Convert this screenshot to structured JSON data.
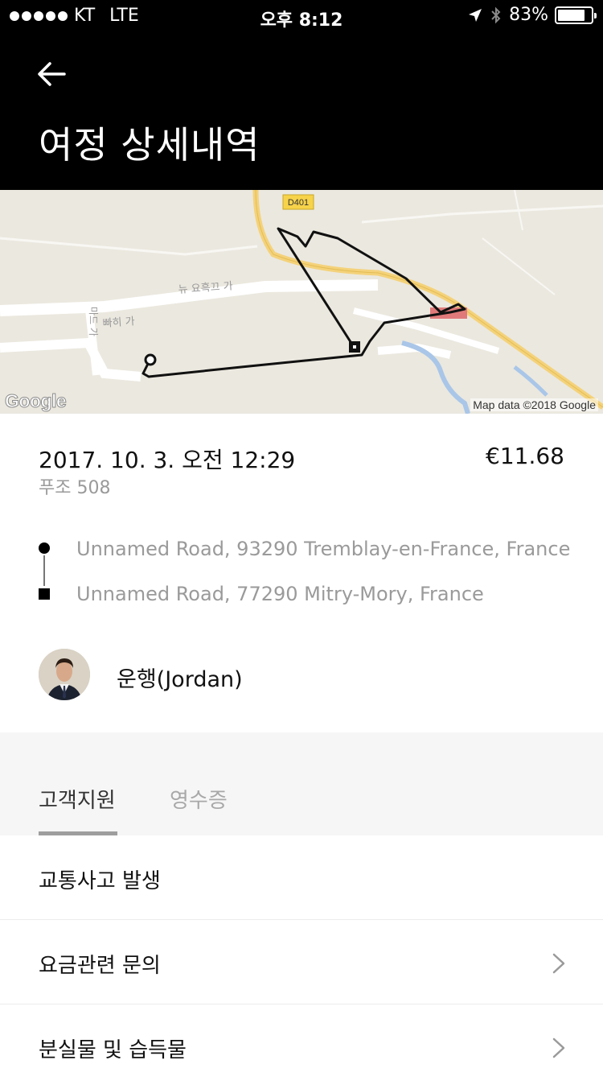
{
  "status_bar": {
    "carrier": "KT",
    "network": "LTE",
    "time": "오후 8:12",
    "battery": "83%",
    "battery_level": 0.83,
    "signal_bars": 5,
    "icons": [
      "location-arrow-icon",
      "bluetooth-icon",
      "battery-icon"
    ]
  },
  "header": {
    "back_icon": "arrow-left-icon",
    "title": "여정 상세내역"
  },
  "map": {
    "road_label": "D401",
    "street_label_1": "뉴 요흑끄 가",
    "street_label_2": "빠히 가",
    "street_label_3": "마드 가",
    "logo": "Google",
    "attribution": "Map data ©2018 Google"
  },
  "trip": {
    "date": "2017. 10. 3. 오전 12:29",
    "fare": "€11.68",
    "vehicle": "푸조 508"
  },
  "route": {
    "pickup": "Unnamed Road, 93290 Tremblay-en-France, France",
    "dropoff": "Unnamed Road, 77290 Mitry-Mory, France"
  },
  "driver": {
    "name": "운행(Jordan)"
  },
  "tabs": [
    {
      "label": "고객지원",
      "active": true
    },
    {
      "label": "영수증",
      "active": false
    }
  ],
  "support_items": [
    {
      "label": "교통사고 발생",
      "chevron": false
    },
    {
      "label": "요금관련 문의",
      "chevron": true
    },
    {
      "label": "분실물 및 습득물",
      "chevron": true
    }
  ],
  "colors": {
    "header_bg": "#000000",
    "route_line": "#000000",
    "map_bg": "#ebe8df",
    "road_yellow": "#f4d27a",
    "water": "#a9c6e8",
    "muted_text": "#9a9a9a"
  }
}
